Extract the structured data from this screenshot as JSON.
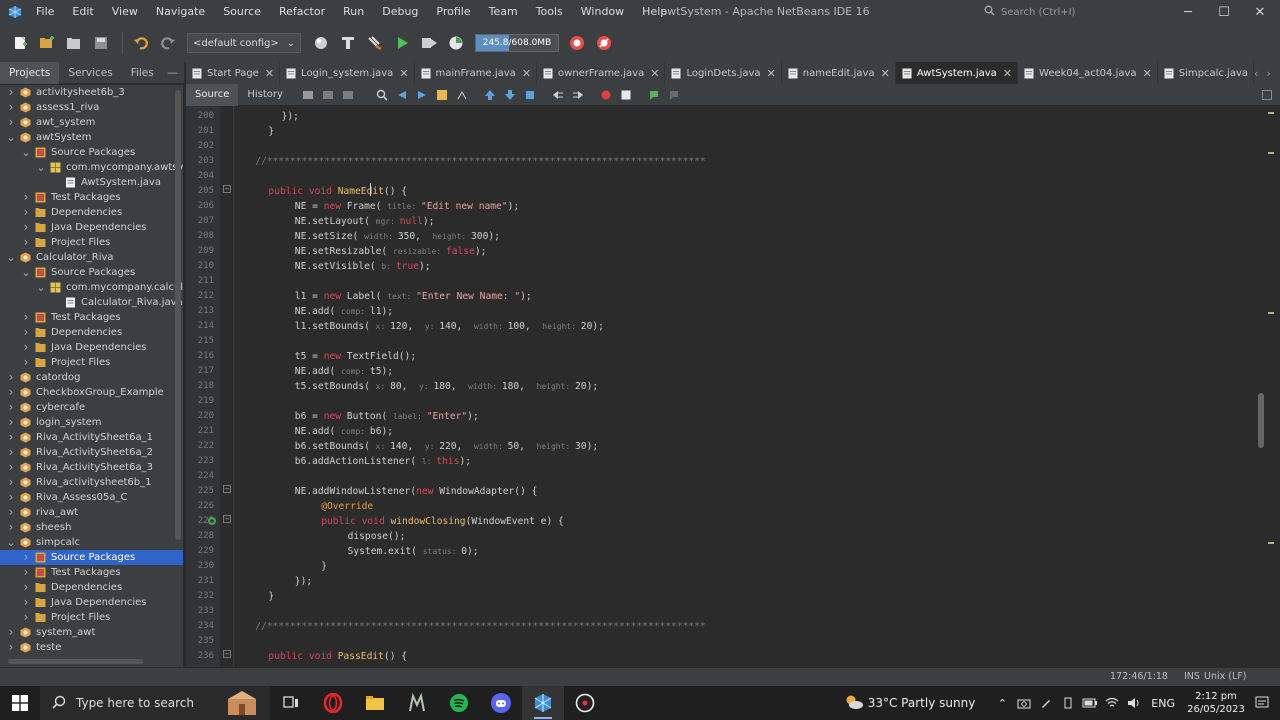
{
  "window": {
    "title": "awtSystem - Apache NetBeans IDE 16",
    "search_placeholder": "Search (Ctrl+I)"
  },
  "menu": [
    "File",
    "Edit",
    "View",
    "Navigate",
    "Source",
    "Refactor",
    "Run",
    "Debug",
    "Profile",
    "Team",
    "Tools",
    "Window",
    "Help"
  ],
  "toolbar": {
    "config": "<default config>",
    "memory": "245.8/608.0MB",
    "memory_fraction": 0.404
  },
  "left_tabs": [
    "Projects",
    "Services",
    "Files"
  ],
  "tree": [
    {
      "d": 0,
      "e": "c",
      "t": "proj",
      "l": "activitysheet6b_3"
    },
    {
      "d": 0,
      "e": "c",
      "t": "proj",
      "l": "assess1_riva"
    },
    {
      "d": 0,
      "e": "c",
      "t": "proj",
      "l": "awt_system"
    },
    {
      "d": 0,
      "e": "o",
      "t": "proj",
      "l": "awtSystem"
    },
    {
      "d": 1,
      "e": "o",
      "t": "pkg",
      "l": "Source Packages"
    },
    {
      "d": 2,
      "e": "o",
      "t": "pk",
      "l": "com.mycompany.awtsys"
    },
    {
      "d": 3,
      "e": "n",
      "t": "java",
      "l": "AwtSystem.java"
    },
    {
      "d": 1,
      "e": "c",
      "t": "pkg",
      "l": "Test Packages"
    },
    {
      "d": 1,
      "e": "c",
      "t": "fold",
      "l": "Dependencies"
    },
    {
      "d": 1,
      "e": "c",
      "t": "fold",
      "l": "Java Dependencies"
    },
    {
      "d": 1,
      "e": "c",
      "t": "fold",
      "l": "Project Files"
    },
    {
      "d": 0,
      "e": "o",
      "t": "proj",
      "l": "Calculator_Riva"
    },
    {
      "d": 1,
      "e": "o",
      "t": "pkg",
      "l": "Source Packages"
    },
    {
      "d": 2,
      "e": "o",
      "t": "pk",
      "l": "com.mycompany.calcula"
    },
    {
      "d": 3,
      "e": "n",
      "t": "java",
      "l": "Calculator_Riva.java"
    },
    {
      "d": 1,
      "e": "c",
      "t": "pkg",
      "l": "Test Packages"
    },
    {
      "d": 1,
      "e": "c",
      "t": "fold",
      "l": "Dependencies"
    },
    {
      "d": 1,
      "e": "c",
      "t": "fold",
      "l": "Java Dependencies"
    },
    {
      "d": 1,
      "e": "c",
      "t": "fold",
      "l": "Project Files"
    },
    {
      "d": 0,
      "e": "c",
      "t": "proj",
      "l": "catordog"
    },
    {
      "d": 0,
      "e": "c",
      "t": "proj",
      "l": "CheckboxGroup_Example"
    },
    {
      "d": 0,
      "e": "c",
      "t": "proj",
      "l": "cybercafe"
    },
    {
      "d": 0,
      "e": "c",
      "t": "proj",
      "l": "login_system"
    },
    {
      "d": 0,
      "e": "c",
      "t": "proj",
      "l": "Riva_ActivitySheet6a_1"
    },
    {
      "d": 0,
      "e": "c",
      "t": "proj",
      "l": "Riva_ActivitySheet6a_2"
    },
    {
      "d": 0,
      "e": "c",
      "t": "proj",
      "l": "Riva_ActivitySheet6a_3"
    },
    {
      "d": 0,
      "e": "c",
      "t": "proj",
      "l": "Riva_activitysheet6b_1"
    },
    {
      "d": 0,
      "e": "c",
      "t": "proj",
      "l": "Riva_Assess05a_C"
    },
    {
      "d": 0,
      "e": "c",
      "t": "proj",
      "l": "riva_awt"
    },
    {
      "d": 0,
      "e": "c",
      "t": "proj",
      "l": "sheesh"
    },
    {
      "d": 0,
      "e": "o",
      "t": "proj",
      "l": "simpcalc"
    },
    {
      "d": 1,
      "e": "c",
      "t": "pkg",
      "l": "Source Packages",
      "sel": true
    },
    {
      "d": 1,
      "e": "c",
      "t": "pkg",
      "l": "Test Packages"
    },
    {
      "d": 1,
      "e": "c",
      "t": "fold",
      "l": "Dependencies"
    },
    {
      "d": 1,
      "e": "c",
      "t": "fold",
      "l": "Java Dependencies"
    },
    {
      "d": 1,
      "e": "c",
      "t": "fold",
      "l": "Project Files"
    },
    {
      "d": 0,
      "e": "c",
      "t": "proj",
      "l": "system_awt"
    },
    {
      "d": 0,
      "e": "c",
      "t": "proj",
      "l": "teste"
    }
  ],
  "editor_tabs": [
    {
      "l": "Start Page"
    },
    {
      "l": "Login_system.java"
    },
    {
      "l": "mainFrame.java"
    },
    {
      "l": "ownerFrame.java"
    },
    {
      "l": "LoginDets.java"
    },
    {
      "l": "nameEdit.java"
    },
    {
      "l": "AwtSystem.java",
      "active": true
    },
    {
      "l": "Week04_act04.java"
    },
    {
      "l": "Simpcalc.java",
      "noclose": true
    }
  ],
  "src_tabs": {
    "source": "Source",
    "history": "History"
  },
  "line_numbers": [
    "200",
    "201",
    "202",
    "203",
    "204",
    "205",
    "206",
    "207",
    "208",
    "209",
    "210",
    "211",
    "212",
    "213",
    "214",
    "215",
    "216",
    "217",
    "218",
    "219",
    "220",
    "221",
    "222",
    "223",
    "224",
    "225",
    "226",
    "227",
    "228",
    "229",
    "230",
    "231",
    "232",
    "233",
    "234",
    "235",
    "236"
  ],
  "code": [
    [
      [
        6,
        "});"
      ]
    ],
    [
      [
        4,
        "}"
      ]
    ],
    [],
    [
      [
        2,
        "//****************************************************************************",
        "cm"
      ]
    ],
    [],
    [
      [
        4,
        "public void ",
        "kw"
      ],
      [
        0,
        "NameEdit",
        "fn"
      ],
      [
        0,
        "() {"
      ]
    ],
    [
      [
        8,
        "NE = "
      ],
      [
        0,
        "new ",
        "kw"
      ],
      [
        0,
        "Frame( "
      ],
      [
        0,
        "title: ",
        "hint"
      ],
      [
        0,
        "\"Edit new name\"",
        "str"
      ],
      [
        0,
        ");"
      ]
    ],
    [
      [
        8,
        "NE.setLayout( "
      ],
      [
        0,
        "mgr: ",
        "hint"
      ],
      [
        0,
        "null",
        "kw"
      ],
      [
        0,
        ");"
      ]
    ],
    [
      [
        8,
        "NE.setSize( "
      ],
      [
        0,
        "width: ",
        "hint"
      ],
      [
        0,
        "350,  "
      ],
      [
        0,
        "height: ",
        "hint"
      ],
      [
        0,
        "300);"
      ]
    ],
    [
      [
        8,
        "NE.setResizable( "
      ],
      [
        0,
        "resizable: ",
        "hint"
      ],
      [
        0,
        "false",
        "kw"
      ],
      [
        0,
        ");"
      ]
    ],
    [
      [
        8,
        "NE.setVisible( "
      ],
      [
        0,
        "b: ",
        "hint"
      ],
      [
        0,
        "true",
        "kw"
      ],
      [
        0,
        ");"
      ]
    ],
    [],
    [
      [
        8,
        "l1 = "
      ],
      [
        0,
        "new ",
        "kw"
      ],
      [
        0,
        "Label( "
      ],
      [
        0,
        "text: ",
        "hint"
      ],
      [
        0,
        "\"Enter New Name: \"",
        "str"
      ],
      [
        0,
        ");"
      ]
    ],
    [
      [
        8,
        "NE.add( "
      ],
      [
        0,
        "comp: ",
        "hint"
      ],
      [
        0,
        "l1);"
      ]
    ],
    [
      [
        8,
        "l1.setBounds( "
      ],
      [
        0,
        "x: ",
        "hint"
      ],
      [
        0,
        "120,  "
      ],
      [
        0,
        "y: ",
        "hint"
      ],
      [
        0,
        "140,  "
      ],
      [
        0,
        "width: ",
        "hint"
      ],
      [
        0,
        "100,  "
      ],
      [
        0,
        "height: ",
        "hint"
      ],
      [
        0,
        "20);"
      ]
    ],
    [],
    [
      [
        8,
        "t5 = "
      ],
      [
        0,
        "new ",
        "kw"
      ],
      [
        0,
        "TextField();"
      ]
    ],
    [
      [
        8,
        "NE.add( "
      ],
      [
        0,
        "comp: ",
        "hint"
      ],
      [
        0,
        "t5);"
      ]
    ],
    [
      [
        8,
        "t5.setBounds( "
      ],
      [
        0,
        "x: ",
        "hint"
      ],
      [
        0,
        "80,  "
      ],
      [
        0,
        "y: ",
        "hint"
      ],
      [
        0,
        "180,  "
      ],
      [
        0,
        "width: ",
        "hint"
      ],
      [
        0,
        "180,  "
      ],
      [
        0,
        "height: ",
        "hint"
      ],
      [
        0,
        "20);"
      ]
    ],
    [],
    [
      [
        8,
        "b6 = "
      ],
      [
        0,
        "new ",
        "kw"
      ],
      [
        0,
        "Button( "
      ],
      [
        0,
        "label: ",
        "hint"
      ],
      [
        0,
        "\"Enter\"",
        "str"
      ],
      [
        0,
        ");"
      ]
    ],
    [
      [
        8,
        "NE.add( "
      ],
      [
        0,
        "comp: ",
        "hint"
      ],
      [
        0,
        "b6);"
      ]
    ],
    [
      [
        8,
        "b6.setBounds( "
      ],
      [
        0,
        "x: ",
        "hint"
      ],
      [
        0,
        "140,  "
      ],
      [
        0,
        "y: ",
        "hint"
      ],
      [
        0,
        "220,  "
      ],
      [
        0,
        "width: ",
        "hint"
      ],
      [
        0,
        "50,  "
      ],
      [
        0,
        "height: ",
        "hint"
      ],
      [
        0,
        "30);"
      ]
    ],
    [
      [
        8,
        "b6.addActionListener( "
      ],
      [
        0,
        "l: ",
        "hint"
      ],
      [
        0,
        "this",
        "kw"
      ],
      [
        0,
        ");"
      ]
    ],
    [],
    [
      [
        8,
        "NE.addWindowListener("
      ],
      [
        0,
        "new ",
        "kw"
      ],
      [
        0,
        "WindowAdapter() {"
      ]
    ],
    [
      [
        12,
        "@Override",
        "an"
      ]
    ],
    [
      [
        12,
        "public void ",
        "kw"
      ],
      [
        0,
        "windowClosing",
        "fn"
      ],
      [
        0,
        "(WindowEvent e) {"
      ]
    ],
    [
      [
        16,
        "dispose();"
      ]
    ],
    [
      [
        16,
        "System.exit( "
      ],
      [
        0,
        "status: ",
        "hint"
      ],
      [
        0,
        "0);"
      ]
    ],
    [
      [
        12,
        "}"
      ]
    ],
    [
      [
        8,
        "});"
      ]
    ],
    [
      [
        4,
        "}"
      ]
    ],
    [],
    [
      [
        2,
        "//****************************************************************************",
        "cm"
      ]
    ],
    [],
    [
      [
        4,
        "public void ",
        "kw"
      ],
      [
        0,
        "PassEdit",
        "fn"
      ],
      [
        0,
        "() {"
      ]
    ]
  ],
  "status": {
    "position": "172:46/1:18",
    "mode": "INS",
    "eol": "Unix (LF)"
  },
  "taskbar": {
    "search_placeholder": "Type here to search",
    "weather": "33°C  Partly sunny",
    "lang": "ENG",
    "time": "2:12 pm",
    "date": "26/05/2023"
  },
  "colors": {
    "accent": "#2f65ca",
    "keyword": "#d2485f",
    "string": "#e6a2a2",
    "method": "#e8bf6a"
  }
}
